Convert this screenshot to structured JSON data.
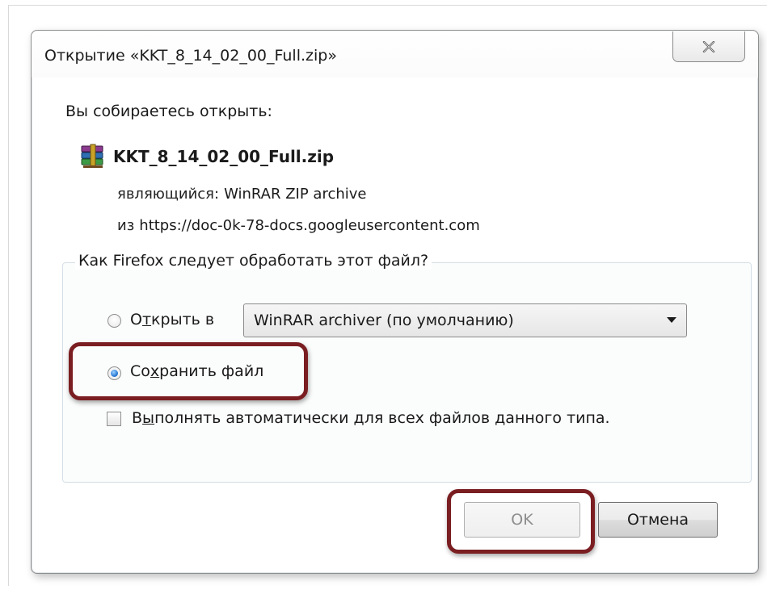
{
  "dialog": {
    "title": "Открытие «KKT_8_14_02_00_Full.zip»",
    "close_icon": "close-x-icon"
  },
  "content": {
    "intro": "Вы собираетесь открыть:",
    "file_icon": "winrar-archive-icon",
    "file_name": "KKT_8_14_02_00_Full.zip",
    "type_label": "являющийся:",
    "type_value": "WinRAR ZIP archive",
    "from_label": "из",
    "from_value": "https://doc-0k-78-docs.googleusercontent.com"
  },
  "group": {
    "legend": "Как Firefox следует обработать этот файл?",
    "open_with": {
      "label_pre": "О",
      "label_u": "т",
      "label_post": "крыть в",
      "checked": false,
      "select_value": "WinRAR archiver (по умолчанию)"
    },
    "save_file": {
      "label_pre": "Со",
      "label_u": "х",
      "label_post": "ранить файл",
      "checked": true
    },
    "auto": {
      "label_pre": "В",
      "label_u": "ы",
      "label_post": "полнять автоматически для всех файлов данного типа.",
      "checked": false
    }
  },
  "buttons": {
    "ok": "OK",
    "cancel": "Отмена"
  },
  "colors": {
    "highlight": "#7a1e22",
    "radio_selected": "#2a7bd6"
  }
}
